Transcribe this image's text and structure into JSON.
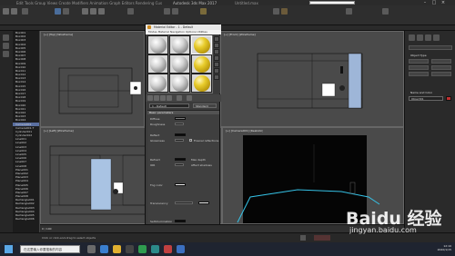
{
  "app": {
    "title": "Autodesk 3ds Max 2017",
    "file": "Untitled.max",
    "menu_hint": "Edit  Tools  Group  Views  Create  Modifiers  Animation  Graph Editors  Rendering  Customize  Scripting  Help"
  },
  "viewports": {
    "top": "[+] [Top] [Wireframe]",
    "front": "[+] [Front] [Wireframe]",
    "left": "[+] [Left] [Wireframe]",
    "perspective": "[+] [Camera001] [Realistic]"
  },
  "explorer": {
    "rows": [
      "Box001",
      "Box002",
      "Box003",
      "Box004",
      "Box005",
      "Box006",
      "Box007",
      "Box008",
      "Box009",
      "Box010",
      "Box011",
      "Box012",
      "Box013",
      "Box014",
      "Box015",
      "Box016",
      "Box017",
      "Box018",
      "Box019",
      "Box020",
      "Box021",
      "Box022",
      "Box023",
      "Box024",
      "Camera001",
      "Camera001.T",
      "Cylinder001",
      "Cylinder002",
      "Line001",
      "Line002",
      "Line003",
      "Line004",
      "Line005",
      "Line006",
      "Line007",
      "Line008",
      "Plane001",
      "Plane002",
      "Plane003",
      "Plane004",
      "Plane005",
      "Plane006",
      "Plane007",
      "Plane008",
      "Rectangle001",
      "Rectangle002",
      "Rectangle003",
      "Rectangle004",
      "Rectangle005",
      "Rectangle006"
    ]
  },
  "material_editor": {
    "title": "Material Editor - 1 - Default",
    "menu": "Modes  Material  Navigation  Options  Utilities",
    "material_name": "1 - Default",
    "material_type": "Standard",
    "basic_params": "Basic parameters",
    "rows": {
      "diffuse": "Diffuse",
      "roughness": "Roughness",
      "reflect": "Reflect",
      "glossiness": "Glossiness",
      "fresnel": "Fresnel reflections",
      "refract": "Refract",
      "ior": "IOR",
      "fog_color": "Fog color",
      "translucency": "Translucency",
      "self_illumination": "Self-illumination",
      "affect_shadows": "Affect shadows",
      "max_depth": "Max depth"
    }
  },
  "command_panel": {
    "object_type": "Object Type",
    "name_color": "Name and Color",
    "name_value": "Object01"
  },
  "status": {
    "frame": "0 / 100",
    "prompt": "Click or click-and-drag to select objects"
  },
  "taskbar": {
    "search_placeholder": "在这里输入你要搜索的内容",
    "time": "12:10",
    "date": "2020/1/15"
  },
  "watermark": {
    "logo": "Baidu 经验",
    "url": "jingyan.baidu.com"
  },
  "colors": {
    "accent": "#5a6fa0",
    "wireframe_cyan": "#35c2e6",
    "material_yellow": "#e8cc2c"
  }
}
